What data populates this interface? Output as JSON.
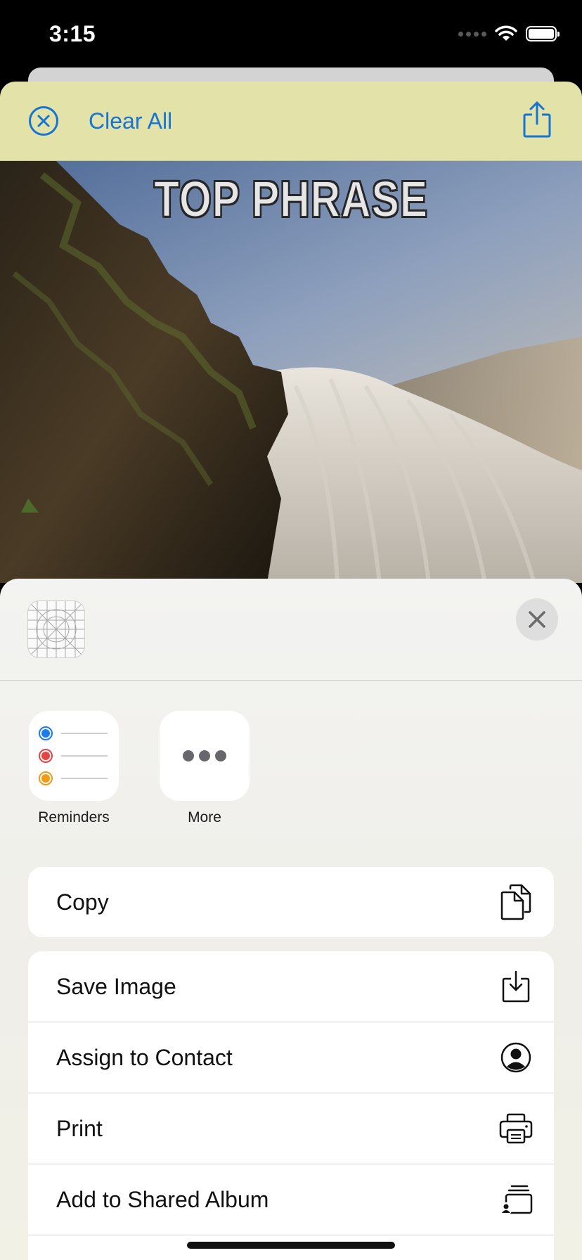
{
  "status_bar": {
    "time": "3:15"
  },
  "nav": {
    "clear_all_label": "Clear All",
    "accent_color": "#1674d4",
    "background_color": "#e2e2a9",
    "icons": {
      "clear": "xmark-circle-icon",
      "share": "share-icon"
    }
  },
  "meme": {
    "top_phrase": "TOP PHRASE"
  },
  "share_sheet": {
    "apps": [
      {
        "label": "Reminders",
        "icon": "reminders-icon"
      },
      {
        "label": "More",
        "icon": "more-icon"
      }
    ],
    "actions_primary": [
      {
        "label": "Copy",
        "icon": "copy-icon"
      }
    ],
    "actions_secondary": [
      {
        "label": "Save Image",
        "icon": "save-image-icon"
      },
      {
        "label": "Assign to Contact",
        "icon": "contact-icon"
      },
      {
        "label": "Print",
        "icon": "print-icon"
      },
      {
        "label": "Add to Shared Album",
        "icon": "shared-album-icon"
      }
    ]
  }
}
